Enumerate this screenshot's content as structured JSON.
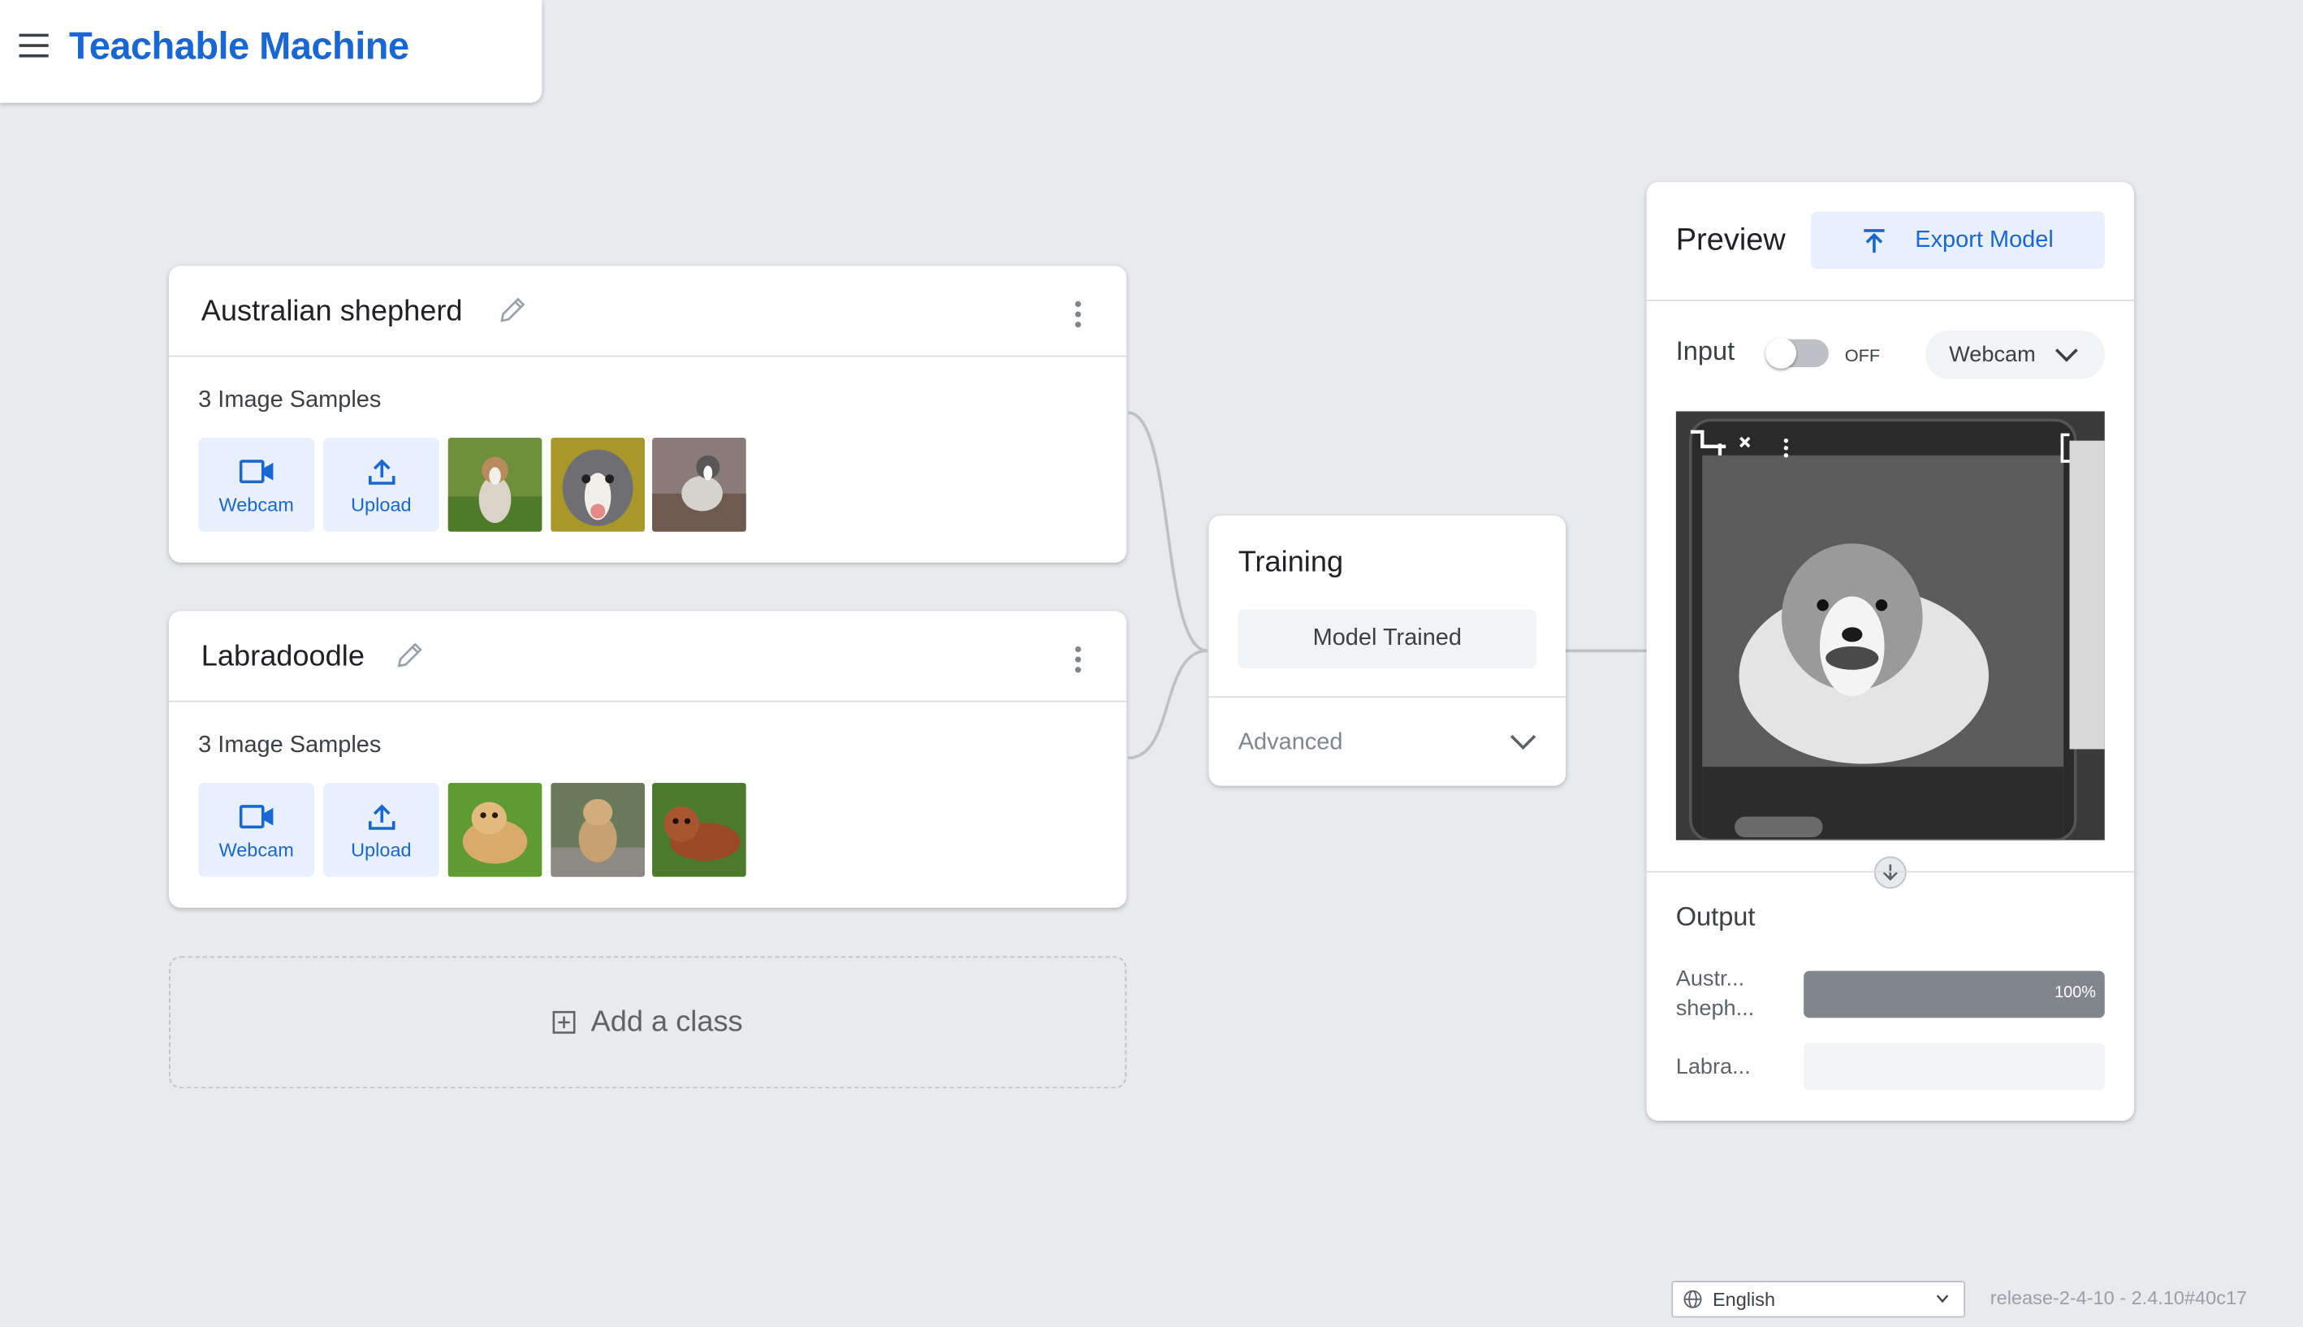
{
  "app": {
    "title": "Teachable Machine"
  },
  "colors": {
    "accent": "#1967d2",
    "accent_bg": "#e8f0fe",
    "bar_fill": "#80868b"
  },
  "classes": [
    {
      "name": "Australian shepherd",
      "samples_label": "3 Image Samples",
      "webcam_label": "Webcam",
      "upload_label": "Upload",
      "thumbnails": [
        "australian-shepherd-sitting-grass",
        "australian-shepherd-headshot",
        "australian-shepherd-running"
      ]
    },
    {
      "name": "Labradoodle",
      "samples_label": "3 Image Samples",
      "webcam_label": "Webcam",
      "upload_label": "Upload",
      "thumbnails": [
        "labradoodle-lying-grass",
        "labradoodle-sitting-path",
        "labradoodle-red-lying"
      ]
    }
  ],
  "add_class": {
    "label": "Add a class"
  },
  "training": {
    "title": "Training",
    "status_button": "Model Trained",
    "advanced_label": "Advanced"
  },
  "preview": {
    "title": "Preview",
    "export_label": "Export Model",
    "input_label": "Input",
    "toggle_state": "OFF",
    "source_select": "Webcam",
    "output_title": "Output",
    "outputs": [
      {
        "label": "Austr... sheph...",
        "percent_text": "100%",
        "confidence": 1.0
      },
      {
        "label": "Labra...",
        "percent_text": "",
        "confidence": 0.0
      }
    ]
  },
  "footer": {
    "language": "English",
    "release": "release-2-4-10 - 2.4.10#40c17"
  }
}
